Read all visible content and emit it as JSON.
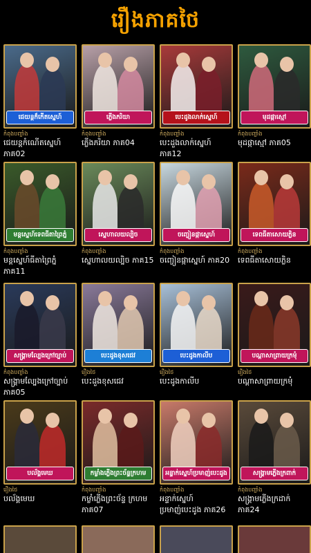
{
  "header": {
    "title": "រឿងភាគថៃ"
  },
  "colors": {
    "accent": "#f4a100",
    "frame": "#caa24a"
  },
  "items": [
    {
      "banner": "ជេយន្តក៏កើតស្នេហ៍",
      "badge": "កំពុងបញ្ចាំង",
      "title": "ជេយន្តកំណើតស្នេហ៍ ភាគ02",
      "bg": "#4a6a8a",
      "bannerColor": "#1d5fd6",
      "figA": "#c23a3a",
      "figB": "#2b3a55"
    },
    {
      "banner": "ភ្លើងភរិយា",
      "badge": "កំពុងបញ្ចាំង",
      "title": "ភ្លើងភរិយា ភាគ04",
      "bg": "#b8a0a8",
      "bannerColor": "#c0155a",
      "figA": "#f0e6e0",
      "figB": "#d48aa0"
    },
    {
      "banner": "បេះដូងលាក់ស្នេហ៍",
      "badge": "កំពុងបញ្ចាំង",
      "title": "បេះដួងលាក់ស្នេហ៍ ភាគ12",
      "bg": "#a83a3a",
      "bannerColor": "#b5121b",
      "figA": "#f4f0ee",
      "figB": "#7a1f2a"
    },
    {
      "banner": "មុដផ្កាស្មៅ",
      "badge": "កំពុងបញ្ចាំង",
      "title": "មុដផ្កាស្មៅ ភាគ05",
      "bg": "#2e5a3e",
      "bannerColor": "#c0155a",
      "figA": "#d06a7a",
      "figB": "#2a2a2a"
    },
    {
      "banner": "មន្តស្នេហ៍ទេពធីតាព្រៃភ្នំ",
      "badge": "កំពុងបញ្ចាំង",
      "title": "មន្តស្នេហ៍ធីតាព្រៃភ្នំ ភាគ11",
      "bg": "#3a5a2a",
      "bannerColor": "#2e7d32",
      "figA": "#6a4a2a",
      "figB": "#3a7a3a"
    },
    {
      "banner": "ស្នេហាលយល្បិច",
      "badge": "កំពុងបញ្ចាំង",
      "title": "ស្នេហាលយល្បិច ភាគ15",
      "bg": "#6a8a5a",
      "bannerColor": "#c0155a",
      "figA": "#e8e8e8",
      "figB": "#2a2a2a"
    },
    {
      "banner": "ចញ្ចៀនផ្កាស្នេហ៍",
      "badge": "កំពុងបញ្ចាំង",
      "title": "ចញ្ចៀនផ្កាស្នេហ៍ ភាគ20",
      "bg": "#c8d8e0",
      "bannerColor": "#c0155a",
      "figA": "#f8f8f8",
      "figB": "#e0a0b0"
    },
    {
      "banner": "ទេពធីតាសោយភ្លិន",
      "badge": "កំពុងបញ្ចាំង",
      "title": "ទេពធីតាសោយភ្លិន",
      "bg": "#7a2a1a",
      "bannerColor": "#c0155a",
      "figA": "#c85a2a",
      "figB": "#b83a3a"
    },
    {
      "banner": "សង្គ្រាមល្បែងក្រៅច្បាប់",
      "badge": "កំពុងបញ្ចាំង",
      "title": "សង្គ្រាមល្បែងក្រៅច្បាប់ ភាគ05",
      "bg": "#2a3a5a",
      "bannerColor": "#c0155a",
      "figA": "#1a1a2a",
      "figB": "#3a3a4a"
    },
    {
      "banner": "បេះដូងខុសជេវ",
      "badge": "រឿងថៃ",
      "title": "បេះដួងខុសជេវ",
      "bg": "#8a7a9a",
      "bannerColor": "#1d7fd6",
      "figA": "#f0e8e0",
      "figB": "#e0c8b0"
    },
    {
      "banner": "បេះដូងកាលីប",
      "badge": "រឿងថៃ",
      "title": "បេះដូងកាលីប",
      "bg": "#a8c0d8",
      "bannerColor": "#1d5fd6",
      "figA": "#f4f4f4",
      "figB": "#e8d8c8"
    },
    {
      "banner": "បណ្ដាសាព្រាយក្រមុំ",
      "badge": "រឿងថៃ",
      "title": "បណ្តាសាព្រាយក្រមុំ",
      "bg": "#3a1a1a",
      "bannerColor": "#c0155a",
      "figA": "#6a2a1a",
      "figB": "#8a3a2a"
    },
    {
      "banner": "បល័ង្គមេឃ",
      "badge": "រឿងថៃ",
      "title": "បល័ង្គមេឃ",
      "bg": "#4a3a1a",
      "bannerColor": "#c0155a",
      "figA": "#2a2a3a",
      "figB": "#c02a2a"
    },
    {
      "banner": "កម្លាំងភ្លើងព្រះច័ន្ទក្រហម",
      "badge": "កំពុងបញ្ចាំង",
      "title": "កម្លាំភ្លើងព្រះច័ន្ទ ក្រហម ភាគ07",
      "bg": "#7a2a2a",
      "bannerColor": "#2e7d32",
      "figA": "#e0c0a0",
      "figB": "#5a1a1a"
    },
    {
      "banner": "អន្ទាក់ស្នេហ៍ប្រមាញ់បេះដូង",
      "badge": "កំពុងបញ្ចាំង",
      "title": "អន្ទាក់ស្នេហ៍ ប្រមាញ់បេះដូង ភាគ26",
      "bg": "#c87a6a",
      "bannerColor": "#c0155a",
      "figA": "#f0d0c0",
      "figB": "#8a2a2a"
    },
    {
      "banner": "សង្គ្រាមភ្លើងក្រពាក់",
      "badge": "កំពុងបញ្ចាំង",
      "title": "សង្គ្រាមភ្លើងក្រដាក់ ភាគ24",
      "bg": "#5a4a3a",
      "bannerColor": "#c0155a",
      "figA": "#1a1a1a",
      "figB": "#6a5a4a"
    }
  ]
}
